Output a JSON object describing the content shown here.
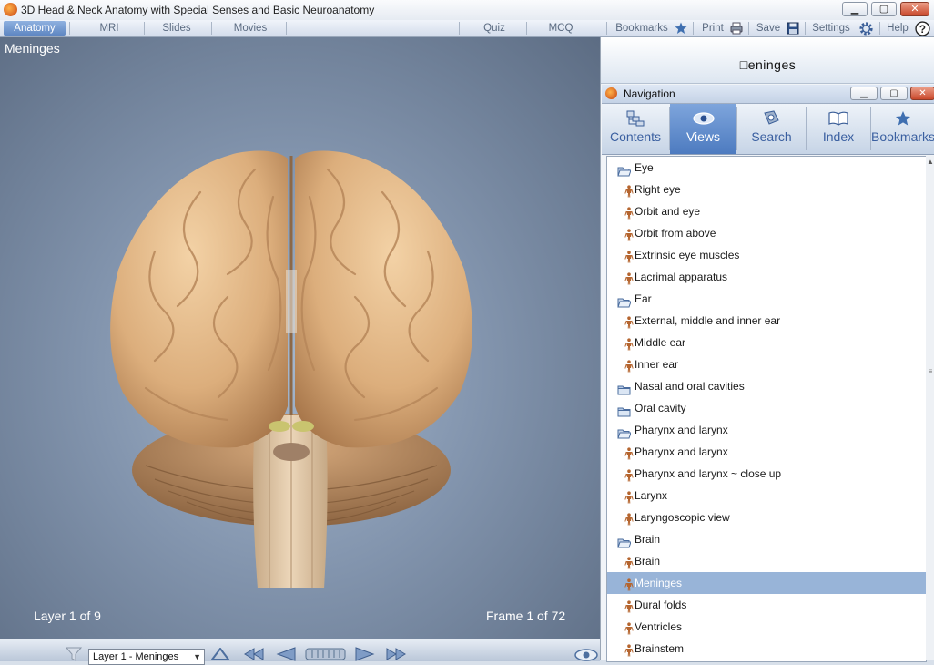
{
  "window": {
    "title": "3D Head & Neck Anatomy with Special Senses and Basic Neuroanatomy",
    "minimize": "▁",
    "maximize": "▢",
    "close": "✕"
  },
  "menubar": {
    "items": [
      {
        "label": "Anatomy",
        "active": true
      },
      {
        "label": "MRI"
      },
      {
        "label": "Slides"
      },
      {
        "label": "Movies"
      },
      {
        "label": "Quiz"
      },
      {
        "label": "MCQ"
      }
    ],
    "right": {
      "bookmarks": "Bookmarks",
      "print": "Print",
      "save": "Save",
      "settings": "Settings",
      "help": "Help"
    },
    "icons": [
      "star-icon",
      "printer-icon",
      "floppy-disk-icon",
      "gear-icon",
      "help-icon"
    ]
  },
  "viewport": {
    "title": "Meninges",
    "layer_info": "Layer 1 of 9",
    "frame_info": "Frame 1 of 72",
    "background_color": "#8294ad",
    "model_color": "#e2b88a"
  },
  "bottombar": {
    "layer_select": "Layer 1 - Meninges",
    "icons": [
      "filter-icon",
      "chevron-down-icon",
      "rewind-icon",
      "step-back-icon",
      "slider-icon",
      "play-icon",
      "fast-forward-icon",
      "eye-icon"
    ]
  },
  "header": {
    "title": "□eninges"
  },
  "navigation": {
    "title": "Navigation",
    "tabs": [
      {
        "label": "Contents",
        "icon": "contents-icon"
      },
      {
        "label": "Views",
        "icon": "eye-icon",
        "active": true
      },
      {
        "label": "Search",
        "icon": "search-icon"
      },
      {
        "label": "Index",
        "icon": "book-icon"
      },
      {
        "label": "Bookmarks",
        "icon": "star-icon"
      }
    ],
    "items": [
      {
        "label": "Eye",
        "type": "folder-open"
      },
      {
        "label": "Right eye",
        "type": "view"
      },
      {
        "label": "Orbit and eye",
        "type": "view"
      },
      {
        "label": "Orbit from above",
        "type": "view"
      },
      {
        "label": "Extrinsic eye muscles",
        "type": "view"
      },
      {
        "label": "Lacrimal apparatus",
        "type": "view"
      },
      {
        "label": "Ear",
        "type": "folder-open"
      },
      {
        "label": "External, middle and inner ear",
        "type": "view"
      },
      {
        "label": "Middle ear",
        "type": "view"
      },
      {
        "label": "Inner ear",
        "type": "view"
      },
      {
        "label": "Nasal and oral cavities",
        "type": "folder-closed"
      },
      {
        "label": "Oral cavity",
        "type": "folder-closed"
      },
      {
        "label": "Pharynx and larynx",
        "type": "folder-open"
      },
      {
        "label": "Pharynx and larynx",
        "type": "view"
      },
      {
        "label": "Pharynx and larynx ~ close up",
        "type": "view"
      },
      {
        "label": "Larynx",
        "type": "view"
      },
      {
        "label": "Laryngoscopic view",
        "type": "view"
      },
      {
        "label": "Brain",
        "type": "folder-open"
      },
      {
        "label": "Brain",
        "type": "view"
      },
      {
        "label": "Meninges",
        "type": "view",
        "selected": true
      },
      {
        "label": "Dural folds",
        "type": "view"
      },
      {
        "label": "Ventricles",
        "type": "view"
      },
      {
        "label": "Brainstem",
        "type": "view"
      }
    ],
    "selected_color": "#98b4d8"
  }
}
